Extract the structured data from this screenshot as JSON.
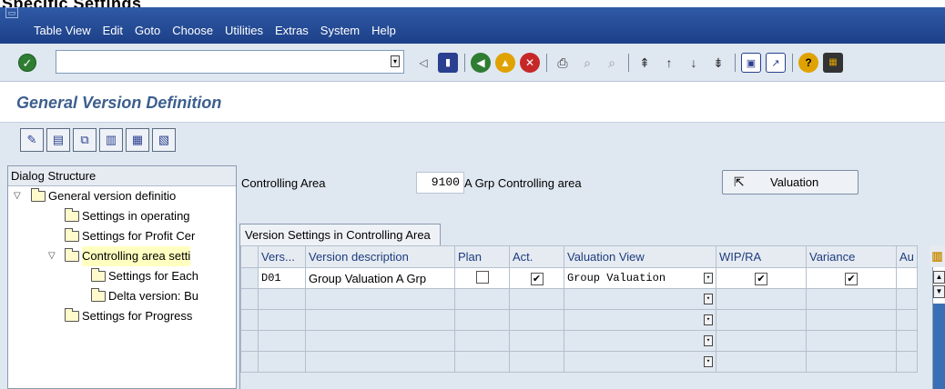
{
  "header": {
    "top_text": "Specific Settings"
  },
  "menubar": {
    "items": [
      "Table View",
      "Edit",
      "Goto",
      "Choose",
      "Utilities",
      "Extras",
      "System",
      "Help"
    ]
  },
  "toolbar": {
    "command_field_value": "",
    "icons": [
      "ok-icon",
      "back-icon",
      "save-icon",
      "green-back-icon",
      "exit-icon",
      "cancel-icon",
      "print-icon",
      "find-icon",
      "find-next-icon",
      "first-page-icon",
      "previous-page-icon",
      "next-page-icon",
      "last-page-icon",
      "create-session-icon",
      "shortcut-icon",
      "help-icon",
      "layout-icon"
    ]
  },
  "page": {
    "title": "General Version Definition"
  },
  "app_toolbar": {
    "icons": [
      "change-display-icon",
      "new-entries-icon",
      "copy-as-icon",
      "delete-icon",
      "select-all-icon",
      "deselect-all-icon"
    ]
  },
  "dialog_structure": {
    "title": "Dialog Structure",
    "items": [
      {
        "label": "General version definitio",
        "level": 0,
        "expanded": true,
        "selected": false
      },
      {
        "label": "Settings in operating",
        "level": 1,
        "expanded": null,
        "selected": false
      },
      {
        "label": "Settings for Profit Cer",
        "level": 1,
        "expanded": null,
        "selected": false
      },
      {
        "label": "Controlling area setti",
        "level": 1,
        "expanded": true,
        "selected": true
      },
      {
        "label": "Settings for Each",
        "level": 2,
        "expanded": null,
        "selected": false
      },
      {
        "label": "Delta version: Bu",
        "level": 2,
        "expanded": null,
        "selected": false
      },
      {
        "label": "Settings for Progress",
        "level": 1,
        "expanded": null,
        "selected": false
      }
    ]
  },
  "controlling_area": {
    "label": "Controlling Area",
    "value": "9100",
    "description": "A Grp Controlling area",
    "valuation_button": "Valuation"
  },
  "version_table": {
    "tab_title": "Version Settings in Controlling Area",
    "columns": [
      "Vers...",
      "Version description",
      "Plan",
      "Act.",
      "Valuation View",
      "WIP/RA",
      "Variance",
      "Au"
    ],
    "rows": [
      {
        "version": "D01",
        "description": "Group Valuation A Grp",
        "plan": false,
        "actual": true,
        "valuation_view": "Group Valuation",
        "wip_ra": true,
        "variance": true
      },
      {
        "version": "",
        "description": "",
        "plan": null,
        "actual": null,
        "valuation_view": "",
        "wip_ra": null,
        "variance": null
      },
      {
        "version": "",
        "description": "",
        "plan": null,
        "actual": null,
        "valuation_view": "",
        "wip_ra": null,
        "variance": null
      },
      {
        "version": "",
        "description": "",
        "plan": null,
        "actual": null,
        "valuation_view": "",
        "wip_ra": null,
        "variance": null
      },
      {
        "version": "",
        "description": "",
        "plan": null,
        "actual": null,
        "valuation_view": "",
        "wip_ra": null,
        "variance": null
      }
    ]
  },
  "colors": {
    "menubar": "#2f5aa6",
    "panel": "#dfe7f0",
    "title": "#3d5f8e"
  }
}
